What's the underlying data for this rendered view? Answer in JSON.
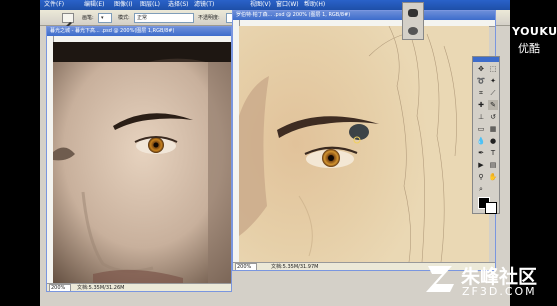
{
  "menubar": {
    "items": [
      "文件(F)",
      "编辑(E)",
      "图像(I)",
      "图层(L)",
      "选择(S)",
      "滤镜(T)",
      "视图(V)",
      "窗口(W)",
      "帮助(H)"
    ]
  },
  "options_bar": {
    "brush_label": "画笔:",
    "mode_label": "模式:",
    "mode_value": "正常",
    "opacity_label": "不透明度:"
  },
  "doc_left": {
    "title": "暮光之城 - 暮光下高... .psd @ 200%(图层 1,RGB/8#)",
    "status": "文档:5.35M/31.26M",
    "zoom": "200%"
  },
  "doc_right": {
    "title": "罗伯特·帕丁森... .psd @ 200% (图层 1, RGB/8#)",
    "status": "文档:5.35M/31.97M",
    "zoom": "200%"
  },
  "watermark": {
    "site_logo_text": "YOUKU",
    "site_logo_sub": "优酷",
    "brand_cn": "朱峰社区",
    "brand_url": "ZF3D.COM"
  },
  "colors": {
    "titlebar": "#3d6ccb",
    "menubar": "#1e4fa8",
    "canvas_bg": "#e9d7b2",
    "iris": "#c8821e"
  },
  "icons": [
    "brush-icon",
    "move-icon",
    "marquee-icon",
    "lasso-icon",
    "magic-wand-icon",
    "crop-icon",
    "slice-icon",
    "healing-icon",
    "brush-tool-icon",
    "stamp-icon",
    "history-brush-icon",
    "eraser-icon",
    "gradient-icon",
    "blur-icon",
    "dodge-icon",
    "pen-icon",
    "type-icon",
    "shape-icon",
    "notes-icon",
    "eyedropper-icon",
    "hand-icon",
    "zoom-icon",
    "foreground-color-icon",
    "background-color-icon"
  ]
}
